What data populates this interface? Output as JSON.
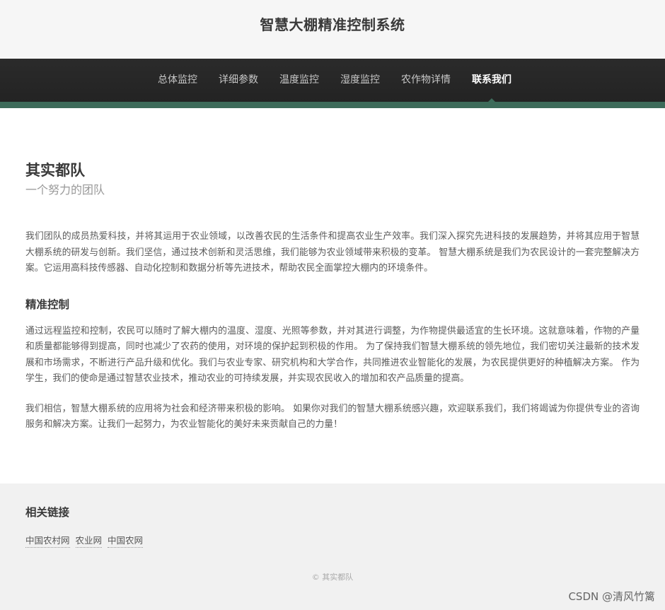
{
  "header": {
    "title": "智慧大棚精准控制系统"
  },
  "nav": {
    "items": [
      {
        "label": "总体监控"
      },
      {
        "label": "详细参数"
      },
      {
        "label": "温度监控"
      },
      {
        "label": "湿度监控"
      },
      {
        "label": "农作物详情"
      },
      {
        "label": "联系我们"
      }
    ],
    "active_index": 5
  },
  "main": {
    "team_name": "其实都队",
    "tagline": "一个努力的团队",
    "intro": "我们团队的成员热爱科技，并将其运用于农业领域，以改善农民的生活条件和提高农业生产效率。我们深入探究先进科技的发展趋势，并将其应用于智慧大棚系统的研发与创新。我们坚信，通过技术创新和灵活思维，我们能够为农业领域带来积极的变革。 智慧大棚系统是我们为农民设计的一套完整解决方案。它运用高科技传感器、自动化控制和数据分析等先进技术，帮助农民全面掌控大棚内的环境条件。",
    "section_heading": "精准控制",
    "section_para_1": "通过远程监控和控制，农民可以随时了解大棚内的温度、湿度、光照等参数，并对其进行调整，为作物提供最适宜的生长环境。这就意味着，作物的产量和质量都能够得到提高，同时也减少了农药的使用，对环境的保护起到积极的作用。 为了保持我们智慧大棚系统的领先地位，我们密切关注最新的技术发展和市场需求，不断进行产品升级和优化。我们与农业专家、研究机构和大学合作，共同推进农业智能化的发展，为农民提供更好的种植解决方案。 作为学生，我们的使命是通过智慧农业技术，推动农业的可持续发展，并实现农民收入的增加和农产品质量的提高。",
    "section_para_2": "我们相信，智慧大棚系统的应用将为社会和经济带来积极的影响。 如果你对我们的智慧大棚系统感兴趣，欢迎联系我们，我们将竭诚为你提供专业的咨询服务和解决方案。让我们一起努力，为农业智能化的美好未来贡献自己的力量！"
  },
  "footer": {
    "heading": "相关链接",
    "links": [
      {
        "label": "中国农村网"
      },
      {
        "label": "农业网"
      },
      {
        "label": "中国农网"
      }
    ],
    "copyright": "© 其实都队"
  },
  "watermark": "CSDN @清风竹篱",
  "colors": {
    "nav_background": "#2b2b2b",
    "accent_green": "#3d6b5a",
    "header_background": "#f6f6f6",
    "footer_background": "#f1f1f1"
  }
}
